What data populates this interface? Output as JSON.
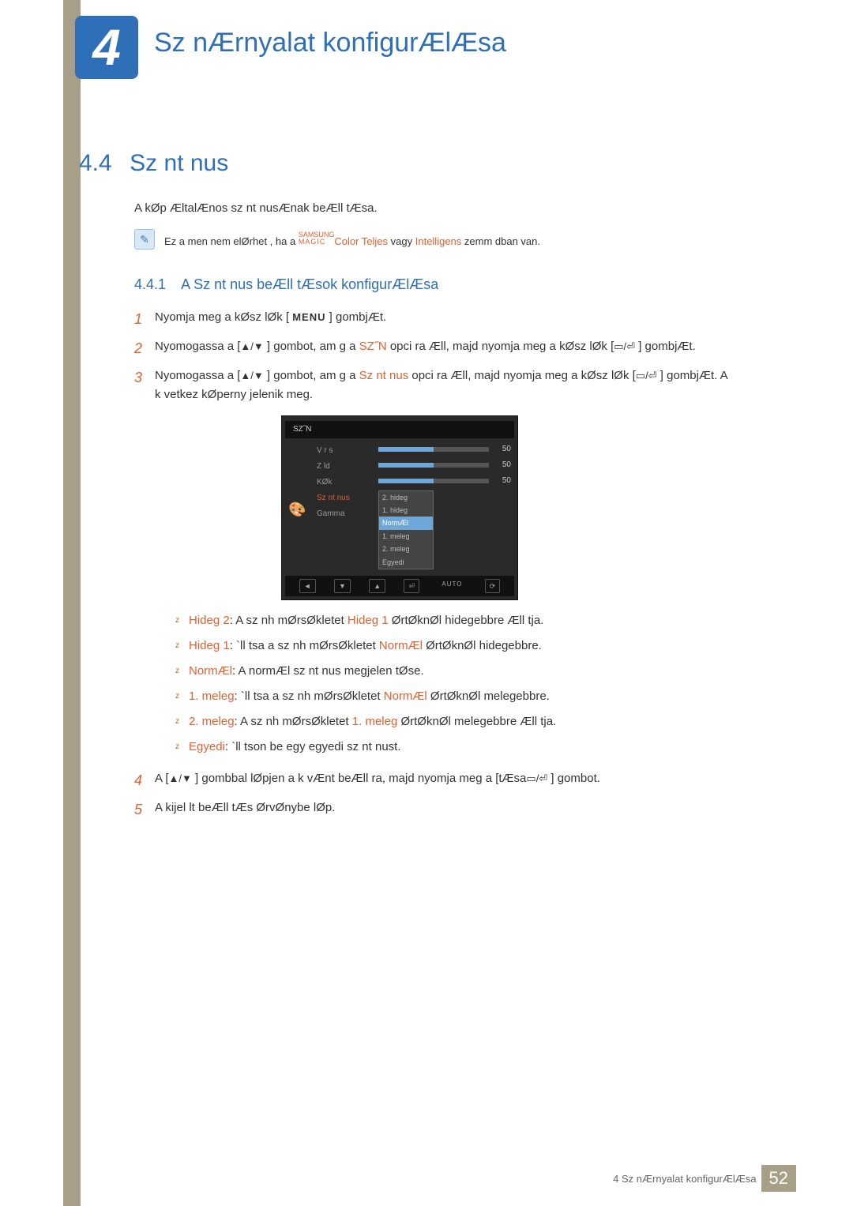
{
  "chapter": {
    "num": "4",
    "title": "Sz nÆrnyalat konfigurÆlÆsa"
  },
  "section": {
    "num": "4.4",
    "title": "Sz nt nus"
  },
  "intro": "A kØp ÆltalÆnos sz nt nusÆnak beÆll tÆsa.",
  "note": {
    "pre": "Ez a men  nem elØrhet , ha a ",
    "magic_top": "SAMSUNG",
    "magic_bot": "MAGIC",
    "color_word": "Color",
    "mid": " ",
    "opt1": "Teljes",
    "sep": " vagy ",
    "opt2": "Intelligens",
    "post": "  zemm dban van."
  },
  "subsection": {
    "num": "4.4.1",
    "title": "A Sz nt nus beÆll tÆsok konfigurÆlÆsa"
  },
  "steps": {
    "s1": {
      "num": "1",
      "pre": "Nyomja meg a kØsz lØk ",
      "menu": "MENU",
      "post": " ] gombjÆt."
    },
    "s2": {
      "num": "2",
      "pre": "Nyomogassa a [",
      "nav": "▲/▼",
      "mid": " ] gombot, am g a ",
      "target": "SZ˝N",
      "mid2": " opci ra Æll, majd nyomja meg a kØsz lØk [",
      "enter": "▭/⏎",
      "post": " ] gombjÆt."
    },
    "s3": {
      "num": "3",
      "pre": "Nyomogassa a [",
      "nav": "▲/▼",
      "mid": " ] gombot, am g a ",
      "target": "Sz nt nus",
      "mid2": "  opci ra Æll, majd nyomja meg a kØsz lØk [",
      "enter": "▭/⏎",
      "post": " ] gombjÆt. A k vetkez  kØperny  jelenik meg."
    },
    "s4": {
      "num": "4",
      "pre": "A [",
      "nav": "▲/▼",
      "mid": " ] gombbal lØpjen a k vÆnt beÆll ra, majd nyomja meg a ",
      "extra": "tÆsa",
      "enter": "▭/⏎",
      "post": " ] gombot."
    },
    "s5": {
      "num": "5",
      "text": "A kijel lt beÆll tÆs ØrvØnybe lØp."
    }
  },
  "osd": {
    "title": "SZ˝N",
    "items": [
      "V r s",
      "Z ld",
      "KØk",
      "Sz nt nus",
      "Gamma"
    ],
    "selected_idx": 3,
    "values": [
      "50",
      "50",
      "50"
    ],
    "dropdown": [
      "2. hideg",
      "1. hideg",
      "NormÆl",
      "1. meleg",
      "2. meleg",
      "Egyedi"
    ],
    "dropdown_hl_idx": 2,
    "footer": [
      "◄",
      "▼",
      "▲",
      "⏎",
      "AUTO",
      "⟳"
    ]
  },
  "bullets": [
    {
      "term": "Hideg 2",
      "sep": ": A sz nh mØrsØkletet ",
      "ref": "Hideg 1",
      "tail": " ØrtØknØl hidegebbre Æll tja."
    },
    {
      "term": "Hideg 1",
      "sep": ": `ll tsa a sz nh mØrsØkletet ",
      "ref": "NormÆl",
      "tail": " ØrtØknØl hidegebbre."
    },
    {
      "term": "NormÆl",
      "sep": ": A normÆl sz nt nus megjelen tØse.",
      "ref": "",
      "tail": ""
    },
    {
      "term": "1. meleg",
      "sep": ": `ll tsa a sz nh mØrsØkletet ",
      "ref": "NormÆl",
      "tail": " ØrtØknØl melegebbre."
    },
    {
      "term": "2. meleg",
      "sep": ": A sz nh mØrsØkletet ",
      "ref": "1. meleg",
      "tail": " ØrtØknØl melegebbre Æll tja."
    },
    {
      "term": "Egyedi",
      "sep": ": `ll tson be egy egyedi sz nt nust.",
      "ref": "",
      "tail": ""
    }
  ],
  "footer": {
    "text": "4 Sz nÆrnyalat konfigurÆlÆsa",
    "page": "52"
  }
}
